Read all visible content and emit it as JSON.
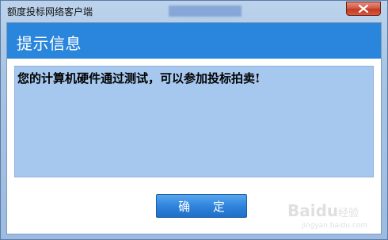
{
  "window": {
    "title": "额度投标网络客户端"
  },
  "dialog": {
    "header_title": "提示信息",
    "message": "您的计算机硬件通过测试，可以参加投标拍卖!",
    "ok_label": "确  定"
  },
  "watermark": {
    "logo": "Baidu",
    "sub": "经验",
    "url": "jingyan.baidu.com"
  },
  "colors": {
    "header_band": "#2a86dc",
    "message_box": "#a6c8ee",
    "ok_button": "#2f84dc",
    "close_button": "#c03a22"
  },
  "icons": {
    "close": "close-icon"
  }
}
